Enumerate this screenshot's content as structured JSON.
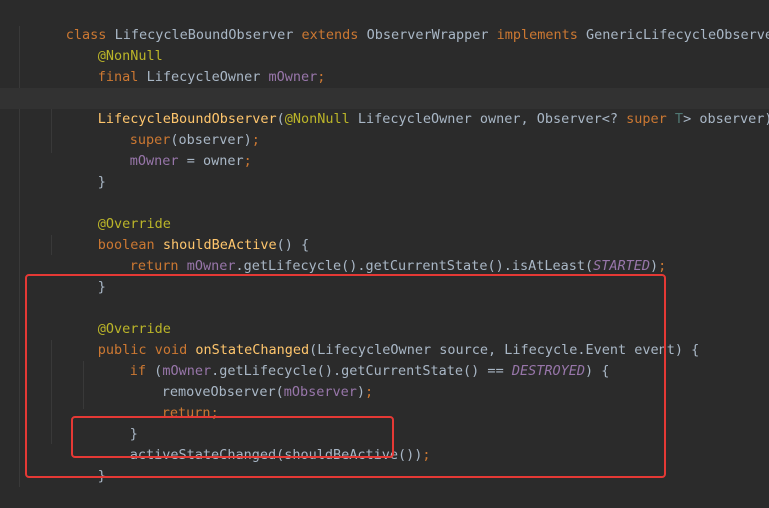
{
  "lines": {
    "l1": {
      "kw_class": "class",
      "name": "LifecycleBoundObserver",
      "kw_extends": "extends",
      "parent": "ObserverWrapper",
      "kw_implements": "implements",
      "iface": "GenericLifecycleObserver",
      "brace": "{"
    },
    "l2": {
      "ann": "@NonNull"
    },
    "l3": {
      "kw_final": "final",
      "type": "LifecycleOwner",
      "field": "mOwner",
      "semi": ";"
    },
    "l5": {
      "ctor": "LifecycleBoundObserver",
      "open": "(",
      "ann": "@NonNull",
      "p1": "LifecycleOwner owner, Observer<?",
      "kw_super": "super",
      "tparam": "T",
      "p2": "> observer) {"
    },
    "l6": {
      "kw_super": "super",
      "args": "(observer)",
      "semi": ";"
    },
    "l7": {
      "field": "mOwner",
      "rest": " = owner",
      "semi": ";"
    },
    "l8": {
      "brace": "}"
    },
    "l10": {
      "ann": "@Override"
    },
    "l11": {
      "kw_boolean": "boolean",
      "fn": "shouldBeActive",
      "rest": "() {"
    },
    "l12": {
      "kw_return": "return",
      "field": "mOwner",
      "call": ".getLifecycle().getCurrentState().isAtLeast(",
      "const": "STARTED",
      "close": ")",
      "semi": ";"
    },
    "l13": {
      "brace": "}"
    },
    "l15": {
      "ann": "@Override"
    },
    "l16": {
      "kw_public": "public",
      "kw_void": "void",
      "fn": "onStateChanged",
      "rest": "(LifecycleOwner source, Lifecycle.Event event) {"
    },
    "l17": {
      "kw_if": "if",
      "open": " (",
      "field": "mOwner",
      "call": ".getLifecycle().getCurrentState() == ",
      "const": "DESTROYED",
      "close": ") {"
    },
    "l18": {
      "call": "removeObserver(",
      "field": "mObserver",
      "close": ")",
      "semi": ";"
    },
    "l19": {
      "kw_return": "return",
      "semi": ";"
    },
    "l20": {
      "brace": "}"
    },
    "l21": {
      "call": "activeStateChanged(shouldBeActive())",
      "semi": ";"
    },
    "l22": {
      "brace": "}"
    }
  },
  "highlight_color": "#e53935"
}
